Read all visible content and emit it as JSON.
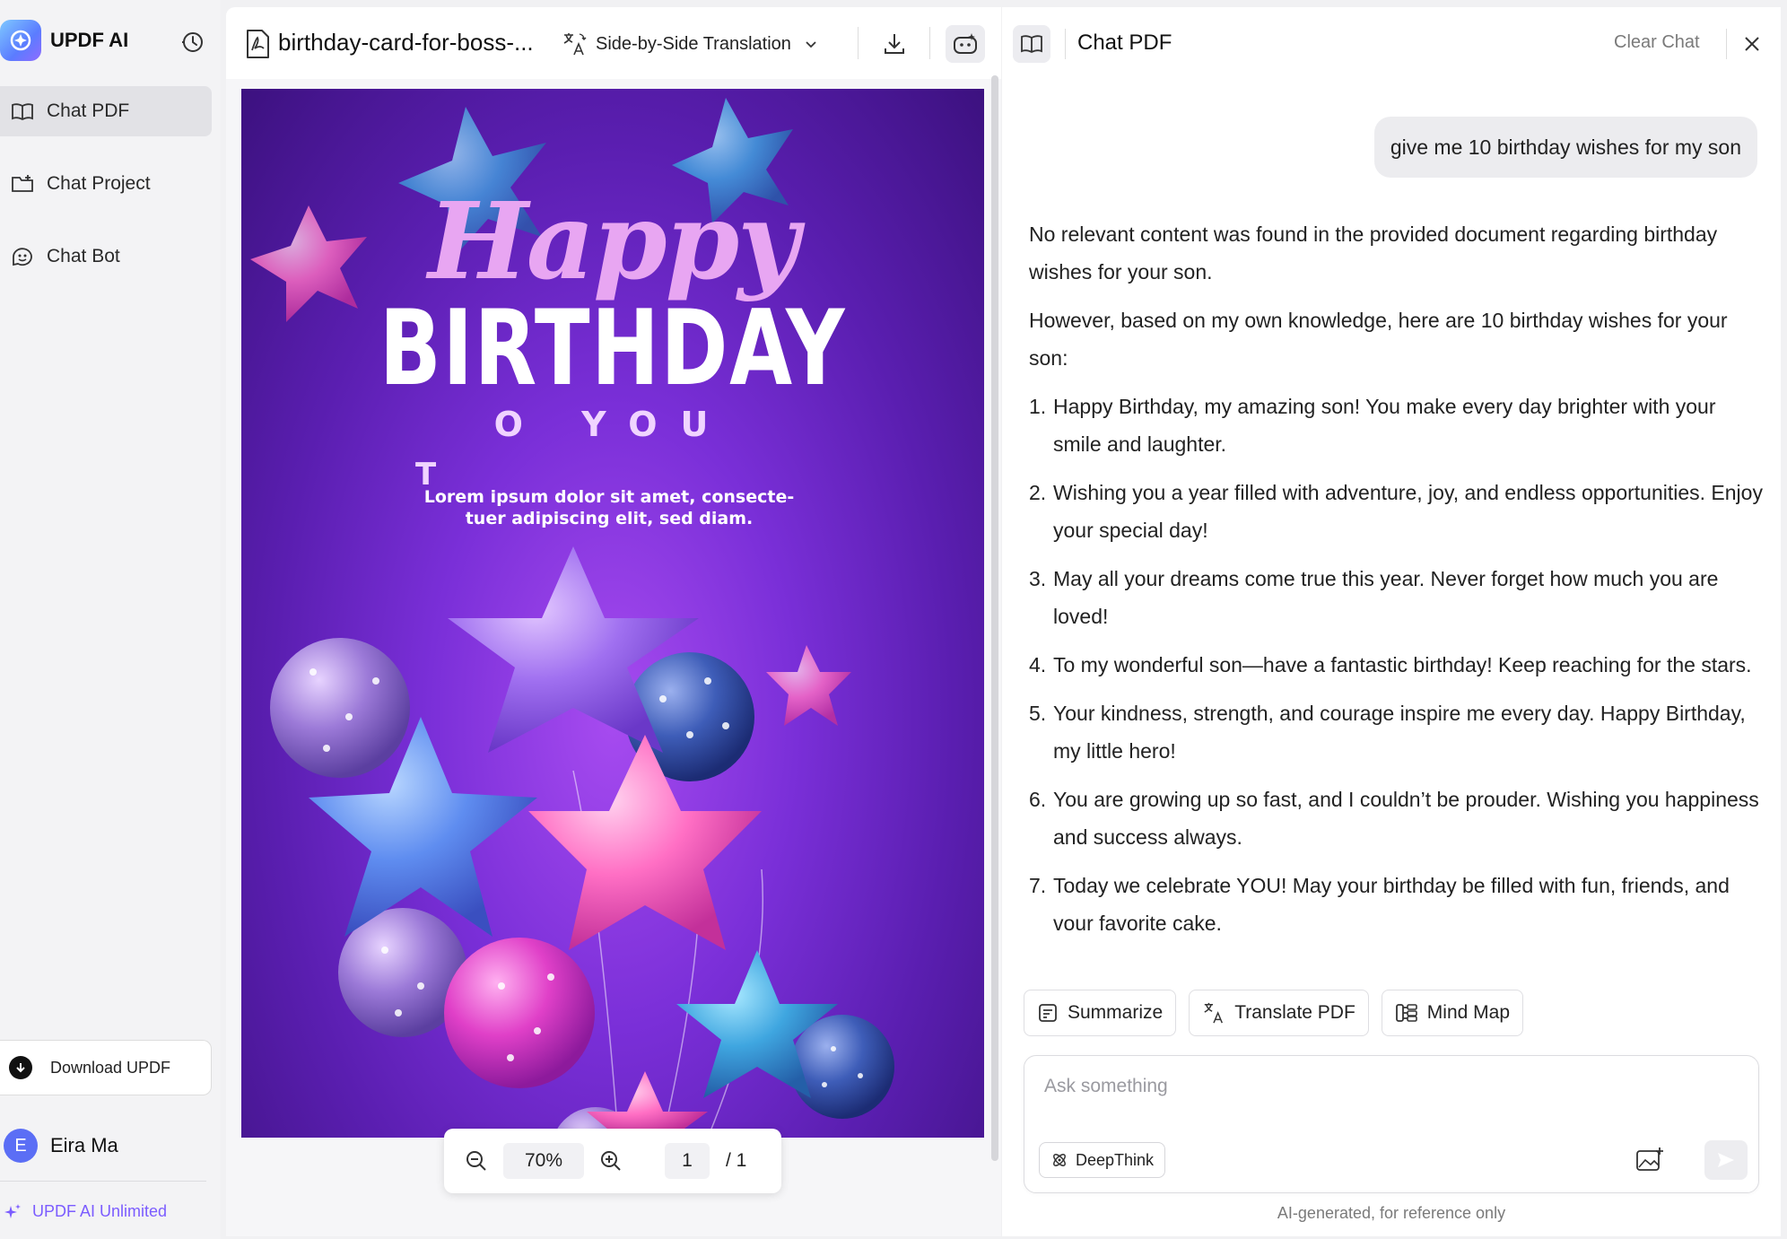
{
  "sidebar": {
    "app_name": "UPDF AI",
    "items": [
      {
        "label": "Chat PDF",
        "icon": "open-book-icon",
        "active": true
      },
      {
        "label": "Chat Project",
        "icon": "folder-icon",
        "active": false
      },
      {
        "label": "Chat Bot",
        "icon": "bot-icon",
        "active": false
      }
    ],
    "download_label": "Download UPDF",
    "user": {
      "initial": "E",
      "name": "Eira Ma"
    },
    "plan_label": "UPDF AI Unlimited"
  },
  "viewer": {
    "file_name": "birthday-card-for-boss-...",
    "translation_mode": "Side-by-Side Translation",
    "zoom": "70%",
    "page_current": "1",
    "page_total": "/ 1",
    "card": {
      "happy": "Happy",
      "birthday": "BIRTHDAY",
      "to_you": "O YOU",
      "t": "T",
      "lorem_line1": "Lorem ipsum dolor sit amet, consecte-",
      "lorem_line2": "tuer adipiscing elit, sed diam."
    }
  },
  "chat": {
    "title": "Chat PDF",
    "clear_label": "Clear Chat",
    "user_message": "give me 10 birthday wishes for my son",
    "answer_p1": "No relevant content was found in the provided document regarding birthday wishes for your son.",
    "answer_p2": "However, based on my own knowledge, here are 10 birthday wishes for your son:",
    "wishes": [
      {
        "num": "1.",
        "text": "Happy Birthday, my amazing son! You make every day brighter with your smile and laughter."
      },
      {
        "num": "2.",
        "text": "Wishing you a year filled with adventure, joy, and endless opportunities. Enjoy your special day!"
      },
      {
        "num": "3.",
        "text": "May all your dreams come true this year. Never forget how much you are loved!"
      },
      {
        "num": "4.",
        "text": "To my wonderful son—have a fantastic birthday! Keep reaching for the stars."
      },
      {
        "num": "5.",
        "text": "Your kindness, strength, and courage inspire me every day. Happy Birthday, my little hero!"
      },
      {
        "num": "6.",
        "text": "You are growing up so fast, and I couldn’t be prouder. Wishing you happiness and success always."
      },
      {
        "num": "7.",
        "text": "Today we celebrate YOU! May your birthday be filled with fun, friends, and vour favorite cake."
      }
    ],
    "chips": [
      {
        "label": "Summarize",
        "icon": "summarize-icon"
      },
      {
        "label": "Translate PDF",
        "icon": "translate-icon"
      },
      {
        "label": "Mind Map",
        "icon": "mind-map-icon"
      }
    ],
    "input_placeholder": "Ask something",
    "deepthink_label": "DeepThink",
    "disclaimer": "AI-generated, for reference only"
  },
  "colors": {
    "accent": "#7b5cff",
    "card_bg": "#7a2fd8",
    "avatar": "#5b6ef5"
  }
}
